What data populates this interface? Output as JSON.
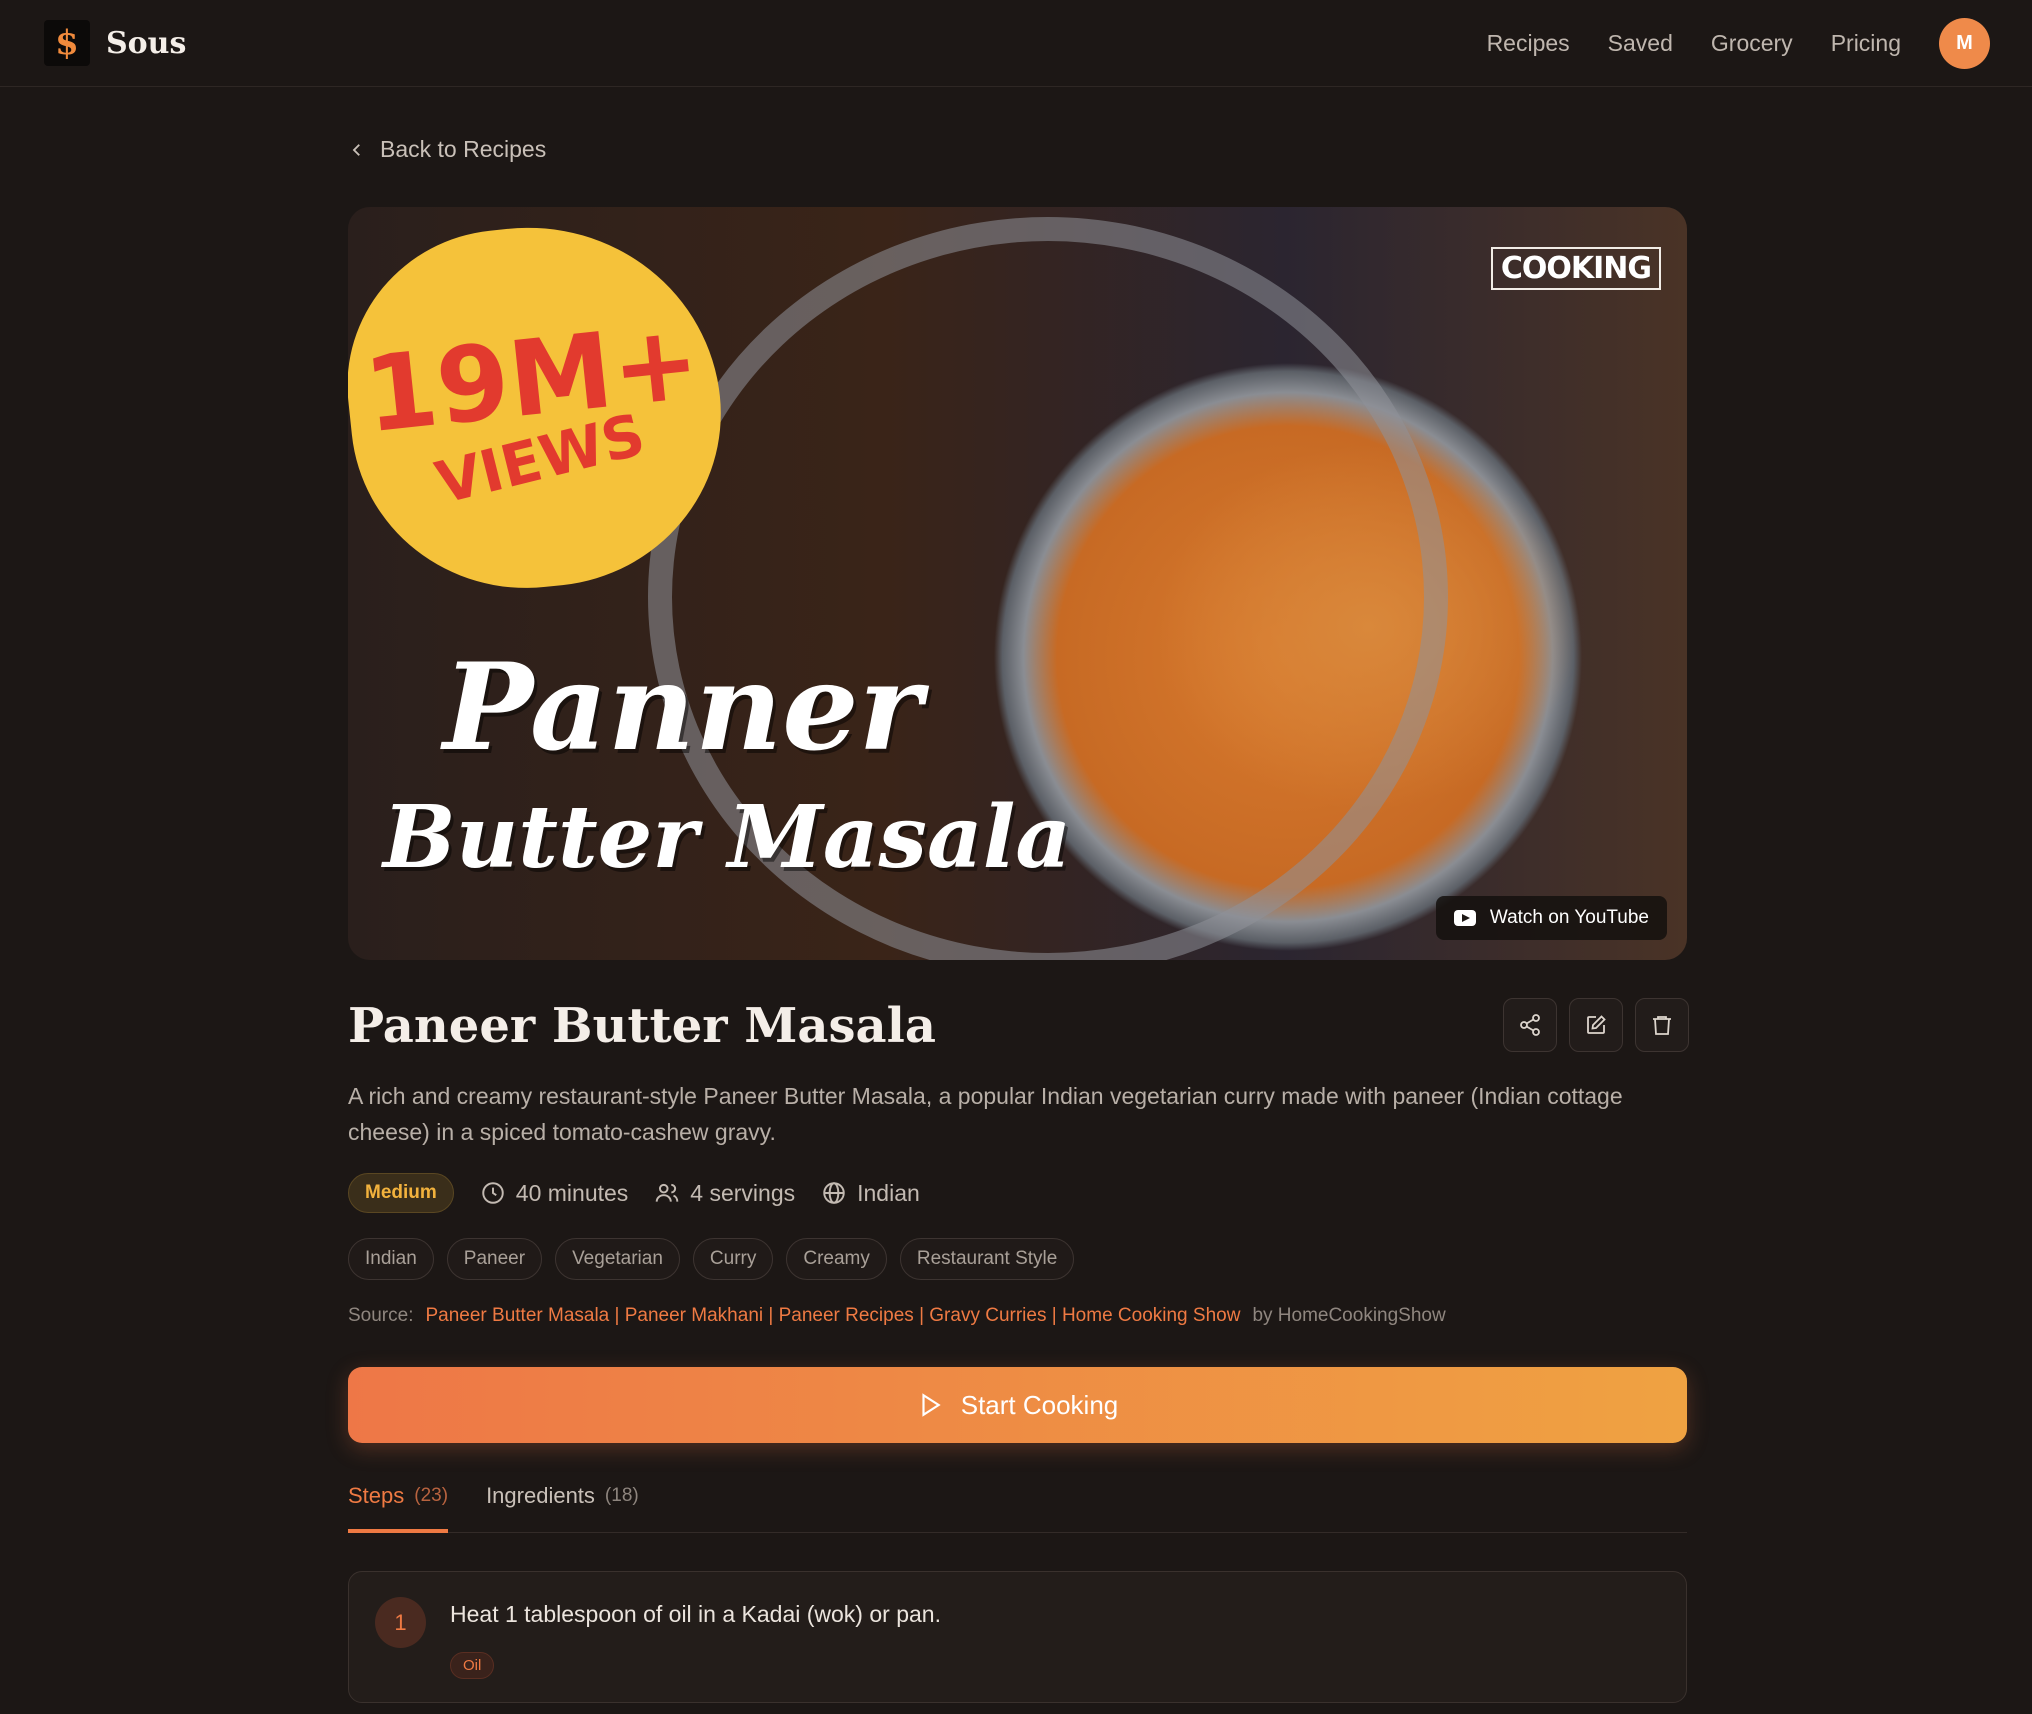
{
  "header": {
    "brand_mark": "$",
    "brand_name": "Sous",
    "nav": [
      "Recipes",
      "Saved",
      "Grocery",
      "Pricing"
    ],
    "avatar_initial": "M"
  },
  "back_label": "Back to Recipes",
  "hero": {
    "overlay_views": "19M+",
    "overlay_views_word": "VIEWS",
    "overlay_title_line1": "Panner",
    "overlay_title_line2": "Butter Masala",
    "channel_brand": "COOKING",
    "youtube_label": "Watch on YouTube"
  },
  "recipe": {
    "title": "Paneer Butter Masala",
    "description": "A rich and creamy restaurant-style Paneer Butter Masala, a popular Indian vegetarian curry made with paneer (Indian cottage cheese) in a spiced tomato-cashew gravy.",
    "difficulty": "Medium",
    "time": "40 minutes",
    "servings": "4 servings",
    "cuisine": "Indian",
    "tags": [
      "Indian",
      "Paneer",
      "Vegetarian",
      "Curry",
      "Creamy",
      "Restaurant Style"
    ],
    "source_label": "Source:",
    "source_title": "Paneer Butter Masala | Paneer Makhani | Paneer Recipes | Gravy Curries | Home Cooking Show",
    "source_author": "by HomeCookingShow"
  },
  "start_cooking_label": "Start Cooking",
  "tabs": [
    {
      "label": "Steps",
      "count": "(23)"
    },
    {
      "label": "Ingredients",
      "count": "(18)"
    }
  ],
  "steps": [
    {
      "number": "1",
      "text": "Heat 1 tablespoon of oil in a Kadai (wok) or pan.",
      "ingredient_tag": "Oil"
    }
  ],
  "colors": {
    "accent": "#ef7a43",
    "background": "#1c1715",
    "difficulty": "#f2b23d"
  }
}
